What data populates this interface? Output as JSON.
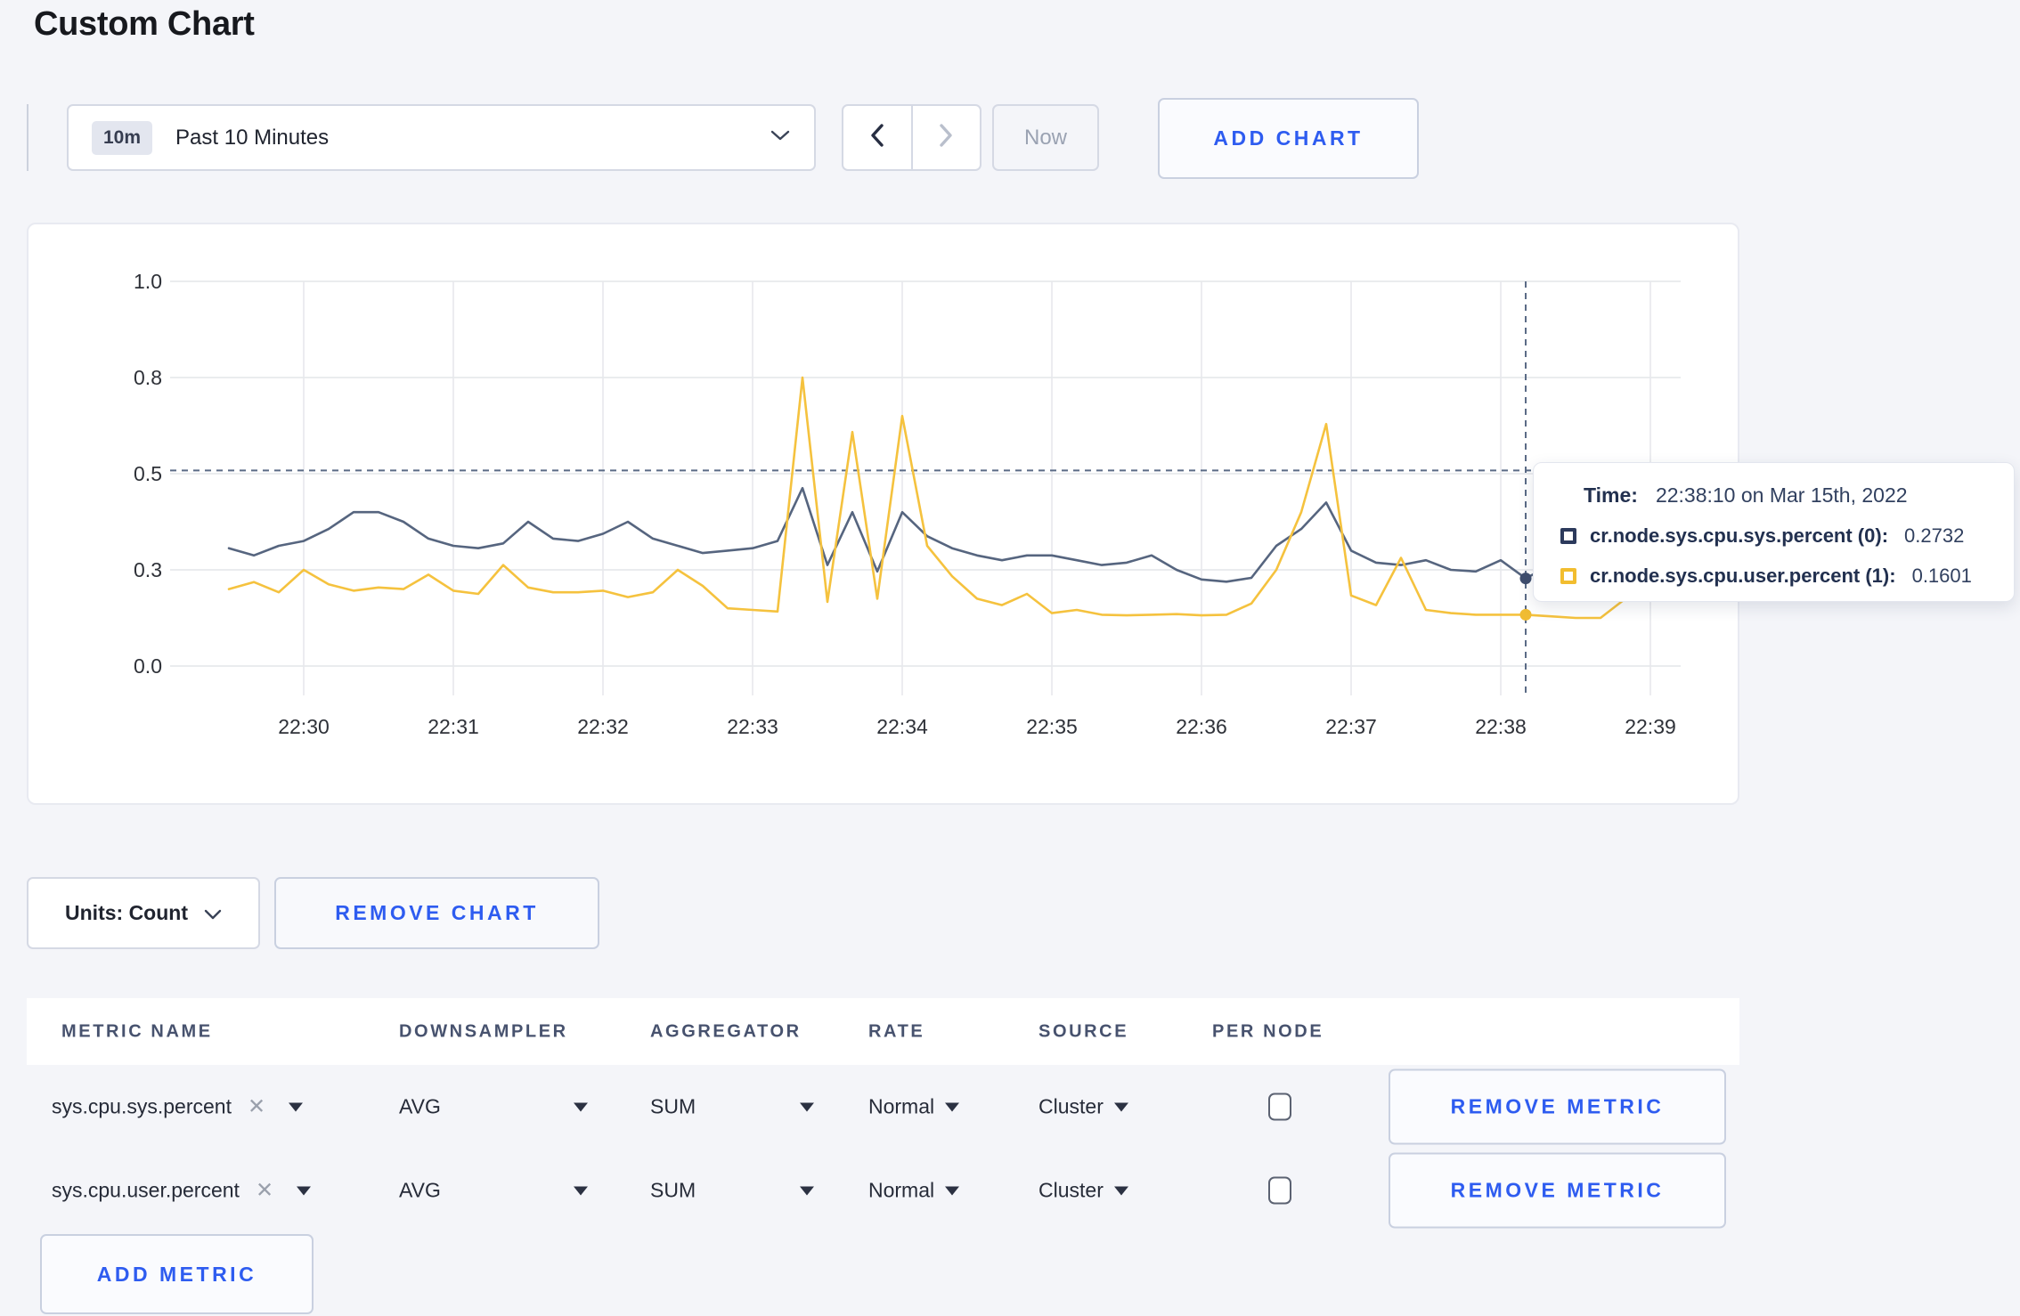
{
  "page": {
    "title": "Custom Chart",
    "background_color": "#f4f5f9",
    "accent_blue": "#2e5cf0"
  },
  "toolbar": {
    "time_window_badge": "10m",
    "time_window_label": "Past 10 Minutes",
    "prev_label": "previous time window",
    "next_label": "next time window",
    "now_label": "Now",
    "add_chart_label": "ADD CHART"
  },
  "chart_data": {
    "type": "line",
    "title": "",
    "xlabel": "",
    "ylabel": "",
    "grid": true,
    "legend_position": "tooltip",
    "y_axis": {
      "ticks": [
        {
          "label": "0.0",
          "value": 0.0
        },
        {
          "label": "0.3",
          "value": 0.3
        },
        {
          "label": "0.5",
          "value": 0.5
        },
        {
          "label": "0.8",
          "value": 0.8
        },
        {
          "label": "1.0",
          "value": 1.0
        }
      ],
      "ylim": [
        0.0,
        1.0
      ]
    },
    "x_axis": {
      "tick_labels": [
        "22:30",
        "22:31",
        "22:32",
        "22:33",
        "22:34",
        "22:35",
        "22:36",
        "22:37",
        "22:38",
        "22:39"
      ],
      "start_time": "22:29:30",
      "point_interval_seconds": 10
    },
    "series": [
      {
        "name": "cr.node.sys.cpu.sys.percent",
        "color": "#56657f",
        "dot_color": "#3f4e6e",
        "values": [
          0.345,
          0.33,
          0.35,
          0.36,
          0.385,
          0.42,
          0.42,
          0.4,
          0.365,
          0.35,
          0.345,
          0.355,
          0.4,
          0.365,
          0.36,
          0.375,
          0.4,
          0.365,
          0.35,
          0.335,
          0.34,
          0.345,
          0.36,
          0.47,
          0.31,
          0.42,
          0.295,
          0.42,
          0.37,
          0.345,
          0.33,
          0.32,
          0.33,
          0.33,
          0.32,
          0.31,
          0.315,
          0.33,
          0.3,
          0.27,
          0.263,
          0.275,
          0.35,
          0.385,
          0.44,
          0.34,
          0.315,
          0.31,
          0.32,
          0.3,
          0.295,
          0.32,
          0.2732,
          0.31,
          0.3,
          0.3,
          0.31,
          0.3,
          0.31
        ]
      },
      {
        "name": "cr.node.sys.cpu.user.percent",
        "color": "#f5c23e",
        "dot_color": "#f0bc33",
        "values": [
          0.24,
          0.262,
          0.23,
          0.3,
          0.255,
          0.235,
          0.245,
          0.24,
          0.285,
          0.235,
          0.225,
          0.31,
          0.245,
          0.23,
          0.23,
          0.235,
          0.215,
          0.23,
          0.3,
          0.25,
          0.18,
          0.175,
          0.17,
          0.8,
          0.2,
          0.63,
          0.21,
          0.68,
          0.35,
          0.28,
          0.21,
          0.19,
          0.225,
          0.165,
          0.175,
          0.16,
          0.158,
          0.16,
          0.162,
          0.158,
          0.16,
          0.195,
          0.3,
          0.42,
          0.655,
          0.22,
          0.19,
          0.325,
          0.175,
          0.165,
          0.16,
          0.16,
          0.1601,
          0.155,
          0.15,
          0.15,
          0.21,
          0.28,
          0.235
        ]
      }
    ],
    "crosshair": {
      "index": 52,
      "time": "22:38:10",
      "hline_value": 0.51
    }
  },
  "tooltip": {
    "time_label": "Time:",
    "time_value": "22:38:10 on Mar 15th, 2022",
    "rows": [
      {
        "label": "cr.node.sys.cpu.sys.percent (0):",
        "value": "0.2732",
        "color": "#2c3a5c"
      },
      {
        "label": "cr.node.sys.cpu.user.percent (1):",
        "value": "0.1601",
        "color": "#f2bd2f"
      }
    ]
  },
  "chart_footer": {
    "units_label": "Units: Count",
    "remove_chart_label": "REMOVE CHART"
  },
  "metrics_table": {
    "headers": [
      "METRIC NAME",
      "DOWNSAMPLER",
      "AGGREGATOR",
      "RATE",
      "SOURCE",
      "PER NODE"
    ],
    "rows": [
      {
        "metric_name": "sys.cpu.sys.percent",
        "downsampler": "AVG",
        "aggregator": "SUM",
        "rate": "Normal",
        "source": "Cluster",
        "per_node_checked": false,
        "remove_label": "REMOVE METRIC"
      },
      {
        "metric_name": "sys.cpu.user.percent",
        "downsampler": "AVG",
        "aggregator": "SUM",
        "rate": "Normal",
        "source": "Cluster",
        "per_node_checked": false,
        "remove_label": "REMOVE METRIC"
      }
    ],
    "add_metric_label": "ADD METRIC"
  }
}
